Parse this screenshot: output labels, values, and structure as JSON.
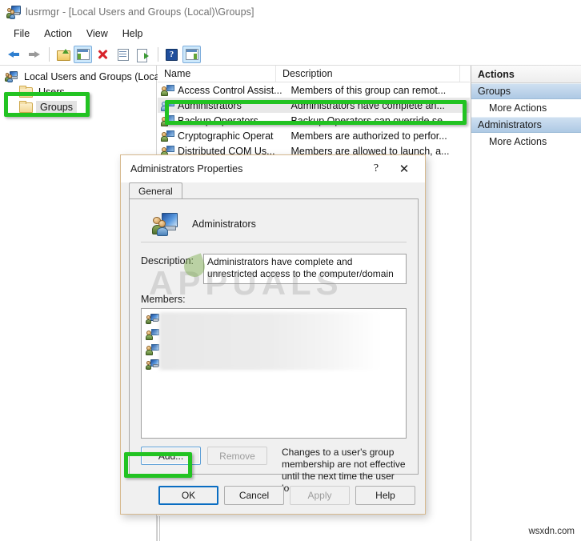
{
  "window": {
    "title": "lusrmgr - [Local Users and Groups (Local)\\Groups]",
    "icon": "users-computer-icon"
  },
  "menu": {
    "items": [
      {
        "label": "File"
      },
      {
        "label": "Action"
      },
      {
        "label": "View"
      },
      {
        "label": "Help"
      }
    ]
  },
  "toolbar": {
    "buttons": [
      {
        "name": "back-icon",
        "label": "Back"
      },
      {
        "name": "forward-icon",
        "label": "Forward"
      },
      {
        "name": "up-one-level-icon",
        "label": "Up One Level"
      },
      {
        "name": "show-console-tree-icon",
        "label": "Show/Hide Console Tree"
      },
      {
        "name": "delete-icon",
        "label": "Delete"
      },
      {
        "name": "properties-icon",
        "label": "Properties"
      },
      {
        "name": "export-list-icon",
        "label": "Export List"
      },
      {
        "name": "help-icon",
        "label": "Help"
      },
      {
        "name": "show-action-pane-icon",
        "label": "Show/Hide Action Pane"
      }
    ]
  },
  "tree": {
    "root": {
      "label": "Local Users and Groups (Local)"
    },
    "children": [
      {
        "label": "Users",
        "selected": false
      },
      {
        "label": "Groups",
        "selected": true
      }
    ]
  },
  "list": {
    "columns": [
      {
        "label": "Name"
      },
      {
        "label": "Description"
      }
    ],
    "rows": [
      {
        "name": "Access Control Assist...",
        "description": "Members of this group can remot...",
        "selected": false
      },
      {
        "name": "Administrators",
        "description": "Administrators have complete an...",
        "selected": true
      },
      {
        "name": "Backup Operators",
        "description": "Backup Operators can override se...",
        "selected": false
      },
      {
        "name": "Cryptographic Operat",
        "description": "Members are authorized to perfor...",
        "selected": false
      },
      {
        "name": "Distributed COM Us...",
        "description": "Members are allowed to launch, a...",
        "selected": false
      }
    ]
  },
  "actions": {
    "title": "Actions",
    "groups": [
      {
        "header": "Groups",
        "items": [
          {
            "label": "More Actions"
          }
        ]
      },
      {
        "header": "Administrators",
        "items": [
          {
            "label": "More Actions"
          }
        ]
      }
    ]
  },
  "dialog": {
    "title": "Administrators Properties",
    "help_button": "?",
    "close_button": "✕",
    "tabs": [
      {
        "label": "General",
        "active": true
      }
    ],
    "group_name": "Administrators",
    "group_icon": "group-users-icon",
    "description_label": "Description:",
    "description_value": "Administrators have complete and unrestricted access to the computer/domain",
    "members_label": "Members:",
    "members": [
      {
        "icon": "user-computer-icon",
        "label": ""
      },
      {
        "icon": "user-group-icon",
        "label": ""
      },
      {
        "icon": "user-group-icon",
        "label": ""
      },
      {
        "icon": "user-computer-icon",
        "label": ""
      }
    ],
    "add_button": "Add...",
    "remove_button": "Remove",
    "note": "Changes to a user's group membership are not effective until the next time the user logs on.",
    "footer": {
      "ok": "OK",
      "cancel": "Cancel",
      "apply": "Apply",
      "help": "Help"
    }
  },
  "highlights": {
    "color": "#22c322",
    "targets": [
      "sidebar-item-groups",
      "list-row-administrators",
      "add-button"
    ]
  },
  "watermarks": {
    "center": "APPUALS",
    "corner": "wsxdn.com"
  }
}
